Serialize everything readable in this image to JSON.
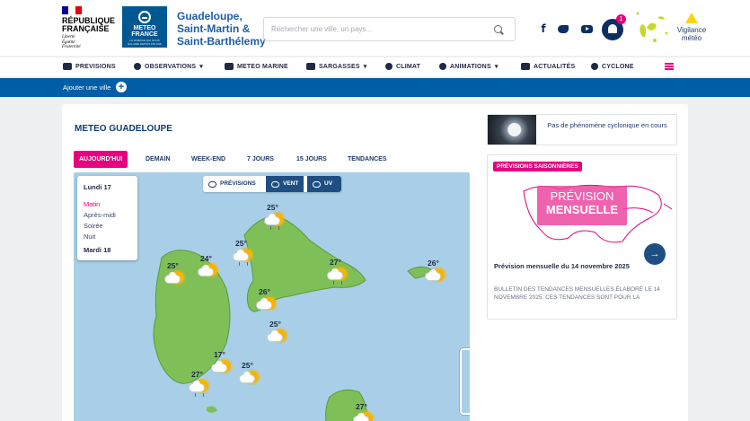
{
  "header": {
    "rf_title": "RÉPUBLIQUE\nFRANÇAISE",
    "rf_motto": "Liberté\nÉgalité\nFraternité",
    "meteo_france": "METEO\nFRANCE",
    "meteo_france_sub": "LA SCIENCE QUI NOUS\nÉCLAIRE DEPUIS 150 ANS",
    "site_title": "Guadeloupe,\nSaint-Martin &\nSaint-Barthélemy",
    "search_placeholder": "Rechercher une ville, un pays...",
    "notification_count": "1",
    "vigilance_label": "Vigilance\nmétéo",
    "vigilance_color": "#ffd400"
  },
  "nav": {
    "items": [
      {
        "label": "PREVISIONS"
      },
      {
        "label": "OBSERVATIONS"
      },
      {
        "label": "METEO MARINE"
      },
      {
        "label": "SARGASSES"
      },
      {
        "label": "CLIMAT"
      },
      {
        "label": "ANIMATIONS"
      },
      {
        "label": "ACTUALITÉS"
      },
      {
        "label": "CYCLONE"
      }
    ]
  },
  "bluebar": {
    "add_city": "Ajouter une ville"
  },
  "main": {
    "title": "METEO GUADELOUPE",
    "tabs": [
      "AUJOURD'HUI",
      "DEMAIN",
      "WEEK-END",
      "7 JOURS",
      "15 JOURS",
      "TENDANCES"
    ],
    "day_panel": {
      "day1": "Lundi 17",
      "periods": [
        "Matin",
        "Après-midi",
        "Soirée",
        "Nuit"
      ],
      "day2": "Mardi 18"
    },
    "modes": [
      "PRÉVISIONS",
      "VENT",
      "UV"
    ],
    "temps": [
      "25°",
      "25°",
      "24°",
      "25°",
      "27°",
      "26°",
      "26°",
      "25°",
      "17°",
      "25°",
      "27°",
      "27°"
    ]
  },
  "aside": {
    "cyclone_text": "Pas de phénomène cyclonique en cours",
    "season_tag": "PRÉVISIONS SAISONNIÈRES",
    "season_banner_a": "PRÉVISION",
    "season_banner_b": "MENSUELLE",
    "season_title": "Prévision mensuelle du 14 novembre 2025",
    "season_desc": "BULLETIN DES TENDANCES MENSUELLES ÉLABORÉ LE 14 NOVEMBRE 2025. CES TENDANCES SONT POUR LA"
  },
  "colors": {
    "accent": "#e6007e",
    "brand": "#005ea6",
    "navy": "#1f4f82"
  }
}
